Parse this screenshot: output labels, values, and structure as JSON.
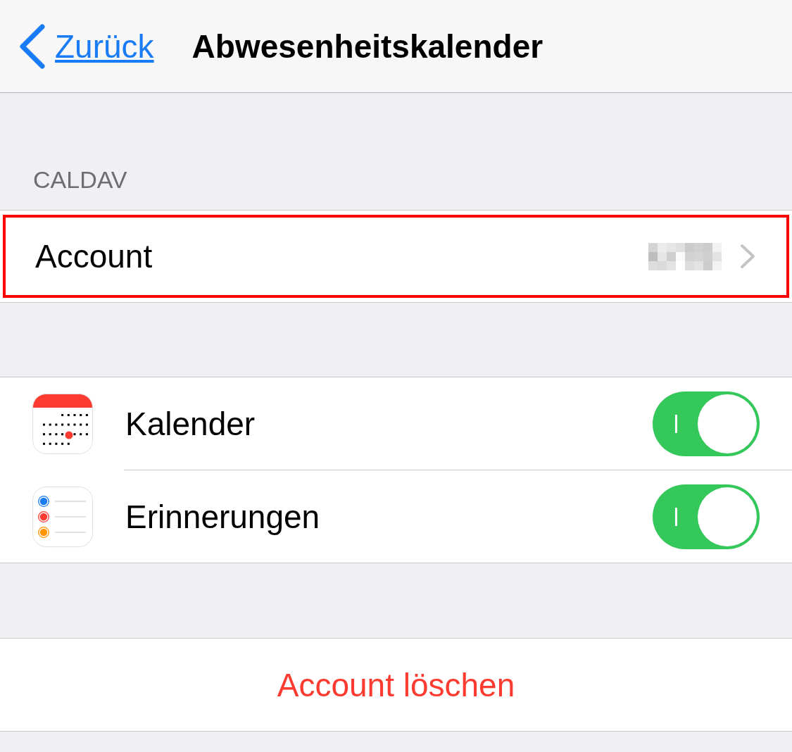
{
  "nav": {
    "back": "Zurück",
    "title": "Abwesenheitskalender"
  },
  "section_header": "CALDAV",
  "account_row": {
    "label": "Account",
    "value_redacted": true,
    "highlighted": true
  },
  "services": [
    {
      "label": "Kalender",
      "kind": "calendar",
      "on": true
    },
    {
      "label": "Erinnerungen",
      "kind": "reminders",
      "on": true
    }
  ],
  "delete_button": "Account löschen"
}
